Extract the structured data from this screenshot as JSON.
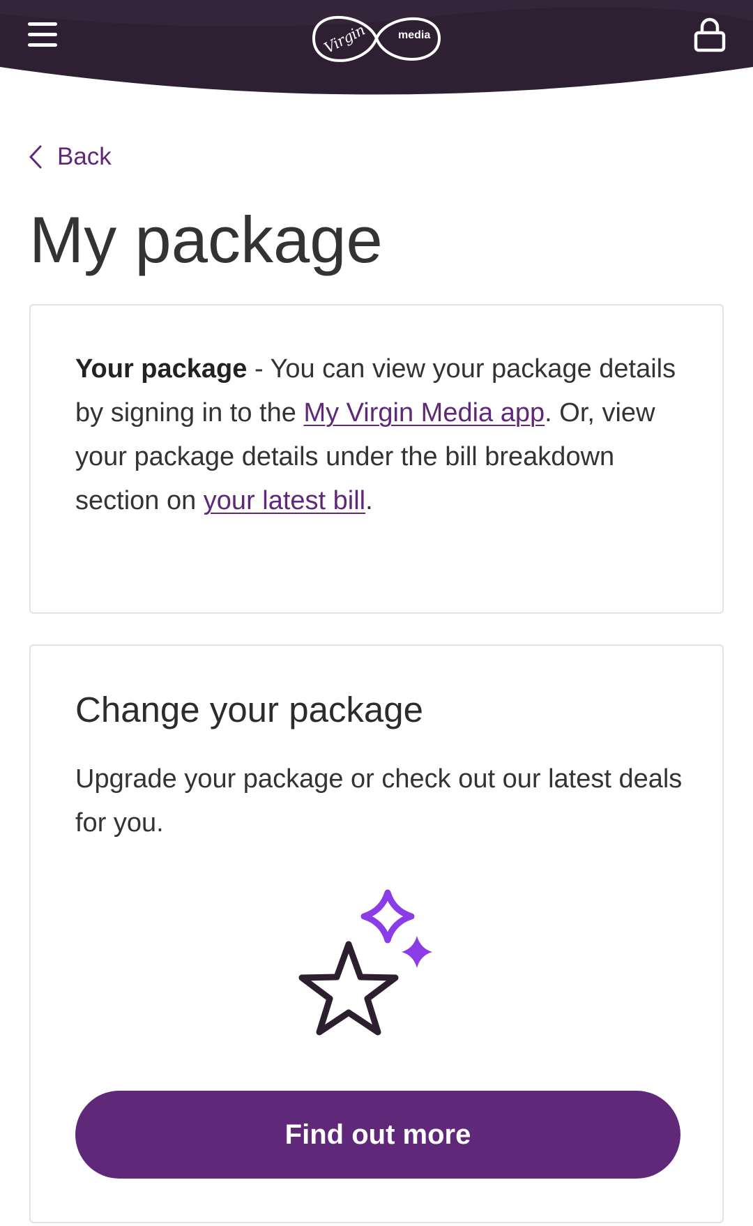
{
  "header": {
    "brand": {
      "virgin": "Virgin",
      "media": "media"
    },
    "menu_icon": "hamburger-menu-icon",
    "lock_icon": "lock-icon",
    "background_color": "#2f1f33"
  },
  "nav": {
    "back_label": "Back",
    "back_icon": "chevron-left-icon"
  },
  "page": {
    "title": "My package"
  },
  "package_info": {
    "heading": "Your package",
    "text_1": " - You can view your package details by signing in to the ",
    "link_app": "My Virgin Media app",
    "text_2": ". Or, view your package details under the bill breakdown section on ",
    "link_bill": "your latest bill",
    "text_3": "."
  },
  "change_package": {
    "title": "Change your package",
    "description": "Upgrade your package or check out our latest deals for you.",
    "illustration": "stars-icon",
    "button_label": "Find out more"
  },
  "colors": {
    "brand_purple": "#5f2878",
    "sparkle_purple": "#8a3ce6",
    "header_dark": "#2f1f33",
    "text": "#333333"
  }
}
